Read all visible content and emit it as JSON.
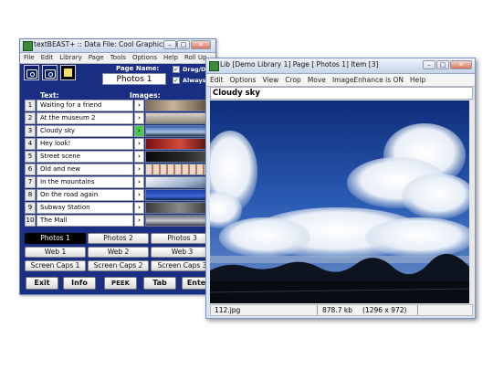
{
  "main_window": {
    "title": "textBEAST+ :: Data File: Cool Graphics.tbi",
    "menu": [
      "File",
      "Edit",
      "Library",
      "Page",
      "Tools",
      "Options",
      "Help",
      "Roll Up"
    ],
    "page_name_label": "Page Name:",
    "page_name": "Photos 1",
    "options": [
      {
        "label": "Drag/Drop O",
        "checked": true
      },
      {
        "label": "Always on To",
        "checked": true
      }
    ],
    "text_header": "Text:",
    "images_header": "Images:",
    "rows": [
      {
        "num": "1",
        "text": "Waiting for a friend"
      },
      {
        "num": "2",
        "text": "At the museum 2"
      },
      {
        "num": "3",
        "text": "Cloudy sky",
        "selected": true
      },
      {
        "num": "4",
        "text": "Hey look!"
      },
      {
        "num": "5",
        "text": "Street scene"
      },
      {
        "num": "6",
        "text": "Old and new"
      },
      {
        "num": "7",
        "text": "In the mountains"
      },
      {
        "num": "8",
        "text": "On the road again"
      },
      {
        "num": "9",
        "text": "Subway Station"
      },
      {
        "num": "10",
        "text": "The Mall"
      }
    ],
    "page_tabs": [
      [
        "Photos 1",
        "Photos 2",
        "Photos 3"
      ],
      [
        "Web 1",
        "Web 2",
        "Web 3"
      ],
      [
        "Screen Caps 1",
        "Screen Caps 2",
        "Screen Caps 3"
      ]
    ],
    "active_tab": "Photos 1",
    "buttons": [
      "Exit",
      "Info",
      "PEEK",
      "Tab",
      "Enter"
    ]
  },
  "viewer": {
    "title": "Lib [Demo Library 1] Page [ Photos 1] Item [3]",
    "menu": [
      "Edit",
      "Options",
      "View",
      "Crop",
      "Move",
      "ImageEnhance is ON",
      "Help"
    ],
    "caption": "Cloudy sky",
    "file": "112.jpg",
    "size": "878.7 kb",
    "dimensions": "(1296 x 972)"
  },
  "colors": {
    "window_bg": "#1a2e83",
    "selected_arrow": "#4ac94a",
    "active_tab": "#000000"
  }
}
